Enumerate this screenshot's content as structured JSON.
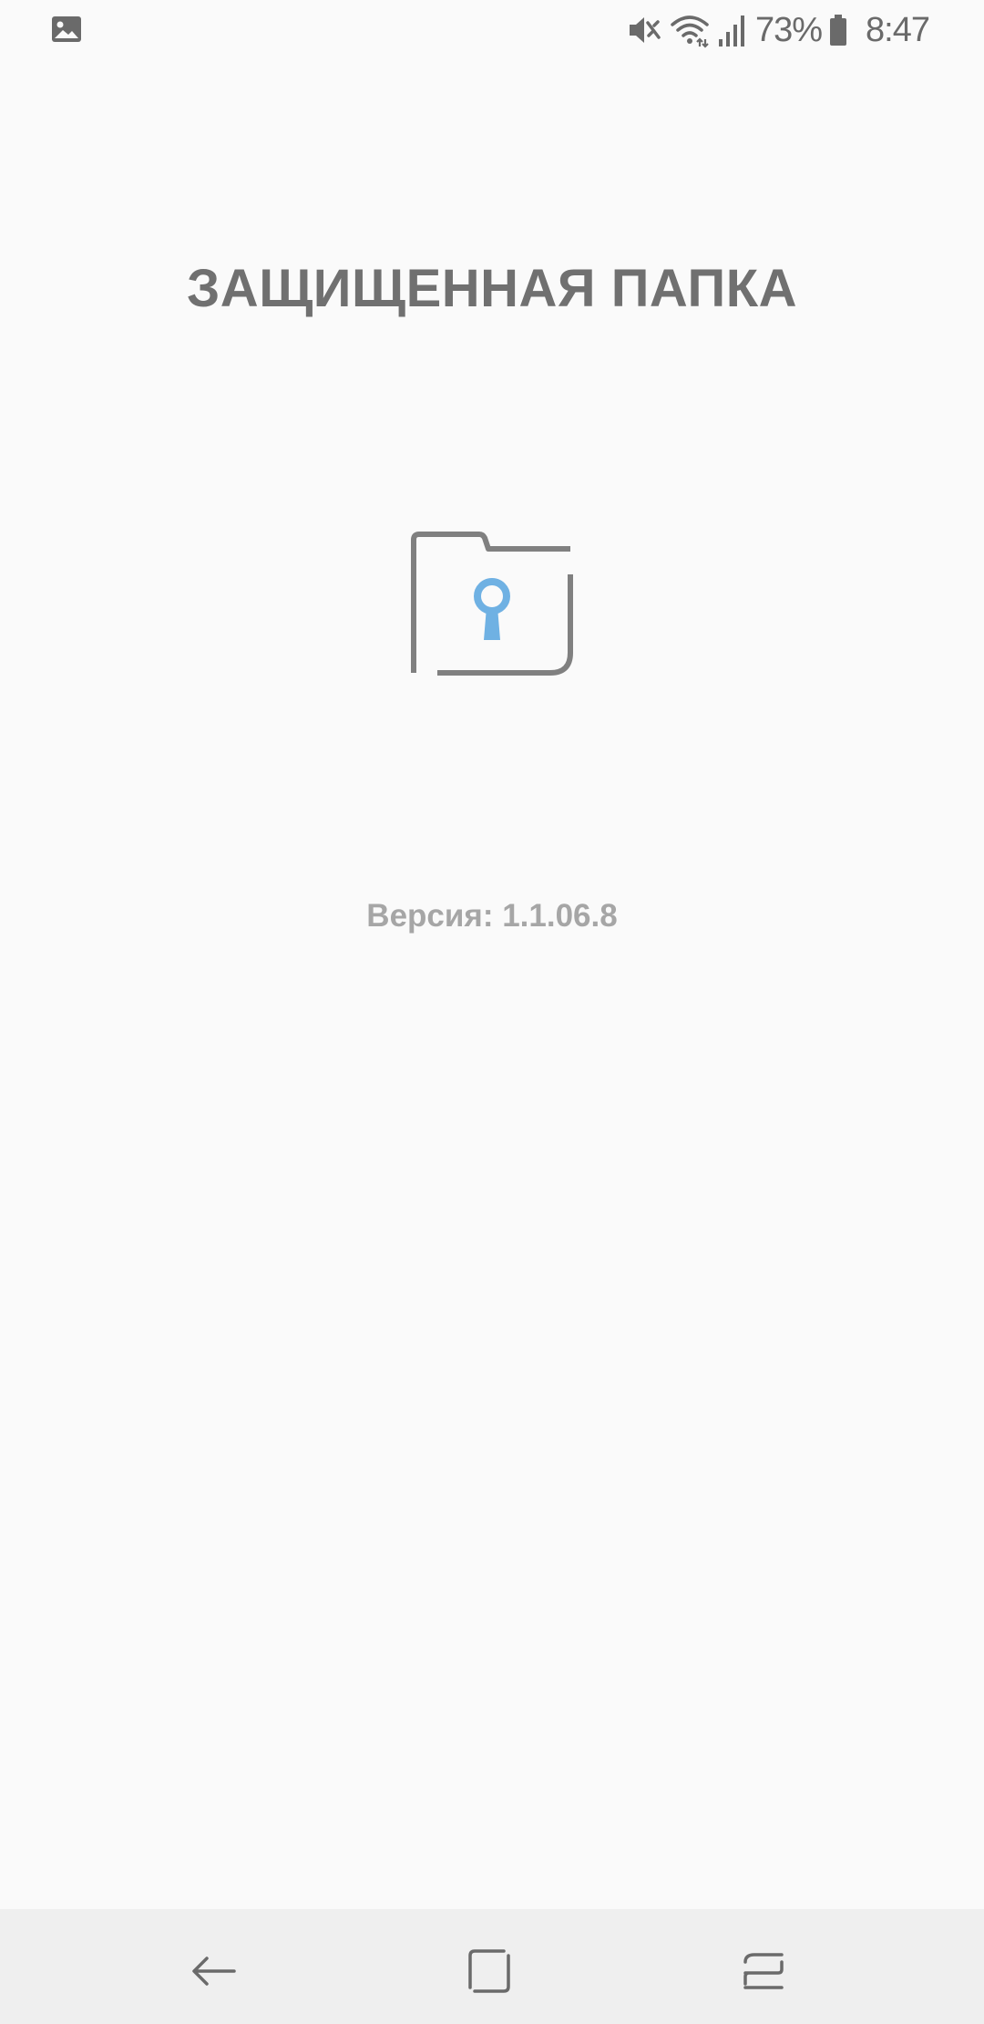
{
  "status_bar": {
    "left_icon": "image-notification-icon",
    "icons": [
      "mute-icon",
      "wifi-icon",
      "signal-icon",
      "battery-icon"
    ],
    "battery_percent": "73%",
    "time": "8:47"
  },
  "main": {
    "title": "ЗАЩИЩЕННАЯ ПАПКА",
    "icon": "secure-folder-icon",
    "version": "Версия: 1.1.06.8"
  },
  "nav_bar": {
    "buttons": [
      "back-icon",
      "home-icon",
      "recent-apps-icon"
    ]
  },
  "colors": {
    "background": "#fafafa",
    "text_primary": "#707070",
    "text_secondary": "#a6a6a6",
    "icon_gray": "#808080",
    "accent_blue": "#6fb1e3",
    "nav_background": "#efefef"
  }
}
